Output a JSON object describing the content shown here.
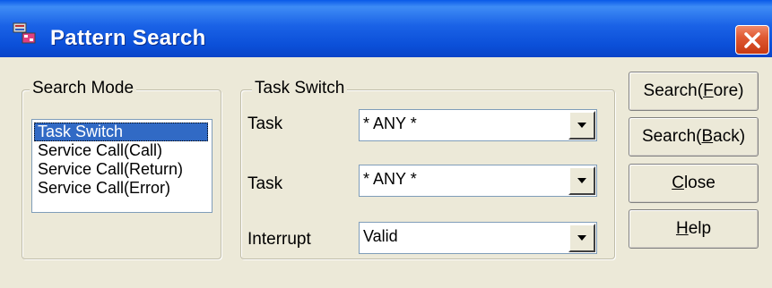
{
  "window": {
    "title": "Pattern Search",
    "title_color": "#0b4fd8"
  },
  "search_mode": {
    "legend": "Search Mode",
    "items": [
      "Task Switch",
      "Service Call(Call)",
      "Service Call(Return)",
      "Service Call(Error)"
    ],
    "selected": "Task Switch"
  },
  "task_switch": {
    "legend": "Task Switch",
    "rows": [
      {
        "label": "Task",
        "value": "* ANY *"
      },
      {
        "label": "Task",
        "value": "* ANY *"
      },
      {
        "label": "Interrupt",
        "value": "Valid"
      }
    ]
  },
  "buttons": {
    "search_fore": {
      "pre": "Search(",
      "mnemonic": "F",
      "post": "ore)"
    },
    "search_back": {
      "pre": "Search(",
      "mnemonic": "B",
      "post": "ack)"
    },
    "close": {
      "pre": "",
      "mnemonic": "C",
      "post": "lose"
    },
    "help": {
      "pre": "",
      "mnemonic": "H",
      "post": "elp"
    }
  },
  "colors": {
    "selection": "#316ac5",
    "dialog_bg": "#ece9d8",
    "close_button": "#e05a33"
  }
}
